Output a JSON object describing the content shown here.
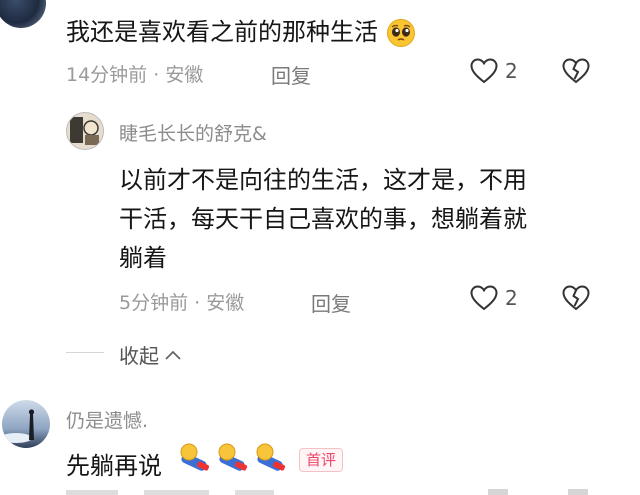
{
  "comment1": {
    "text": "我还是喜欢看之前的那种生活",
    "emoji_icon": "pleading-face-emoji",
    "time": "14分钟前",
    "location": "安徽",
    "separator": "·",
    "reply_label": "回复",
    "likes": "2"
  },
  "reply1": {
    "username": "睫毛长长的舒克&",
    "text_lines": [
      "以前才不是向往的生活，这才是，不用",
      "干活，每天干自己喜欢的事，想躺着就",
      "躺着"
    ],
    "time": "5分钟前",
    "location": "安徽",
    "separator": "·",
    "reply_label": "回复",
    "likes": "2"
  },
  "collapse": {
    "label": "收起"
  },
  "comment2": {
    "username": "仍是遗憾.",
    "text": "先躺再说",
    "emoji_icon": "lying-flat-emoji",
    "tag": "首评"
  },
  "colors": {
    "accent": "#f0466a",
    "meta": "#9a9a9a"
  }
}
